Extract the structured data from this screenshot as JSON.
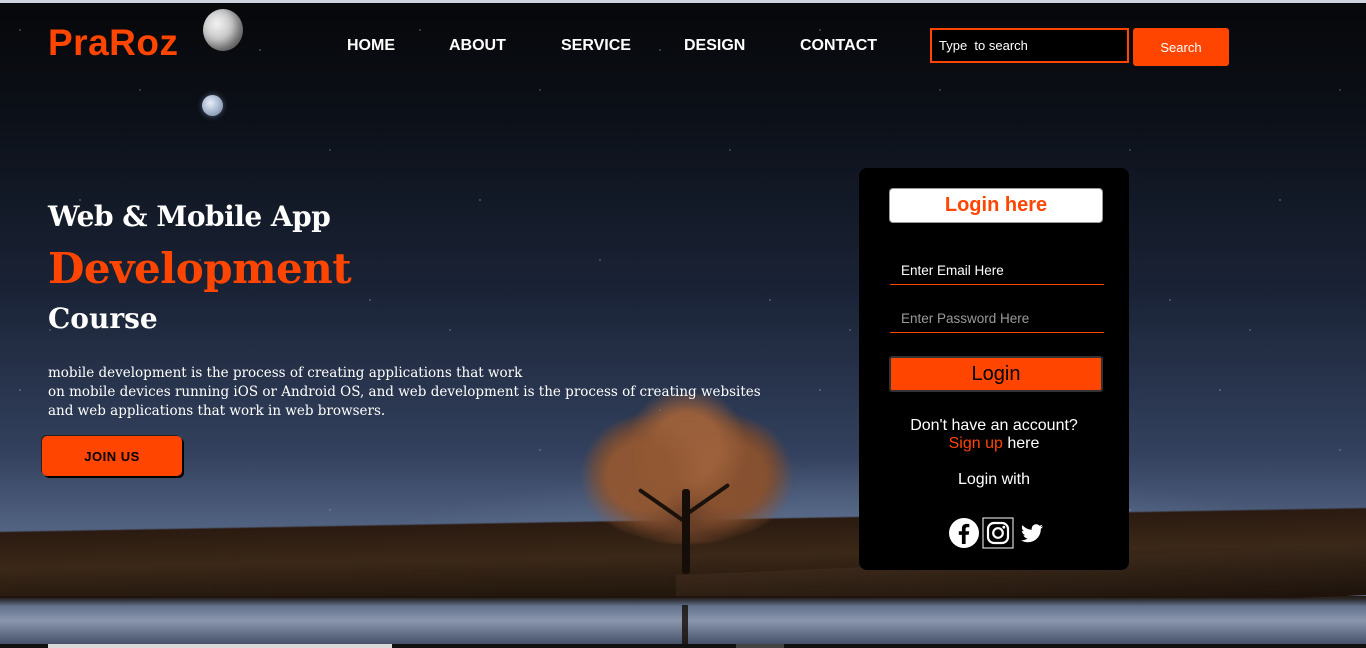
{
  "brand": {
    "name": "PraRoz",
    "accent_color": "#ff4500"
  },
  "nav": {
    "items": [
      {
        "label": "HOME"
      },
      {
        "label": "ABOUT"
      },
      {
        "label": "SERVICE"
      },
      {
        "label": "DESIGN"
      },
      {
        "label": "CONTACT"
      }
    ]
  },
  "search": {
    "placeholder": "Type  to search",
    "button_label": "Search"
  },
  "hero": {
    "line1": "Web & Mobile App",
    "line2": "Development",
    "line3": "Course",
    "description": [
      "mobile development is the process of creating applications that work",
      "on mobile devices running iOS or Android OS, and web development is the process of creating websites",
      "and web applications that work in web browsers."
    ],
    "join_label": "JOIN US"
  },
  "login": {
    "title": "Login here",
    "email_placeholder": "Enter Email Here",
    "password_placeholder": "Enter Password Here",
    "button_label": "Login",
    "no_account": "Don't have an account?",
    "signup_link": "Sign up",
    "signup_suffix": " here",
    "login_with": "Login with",
    "socials": [
      "facebook-icon",
      "instagram-icon",
      "twitter-icon"
    ]
  }
}
